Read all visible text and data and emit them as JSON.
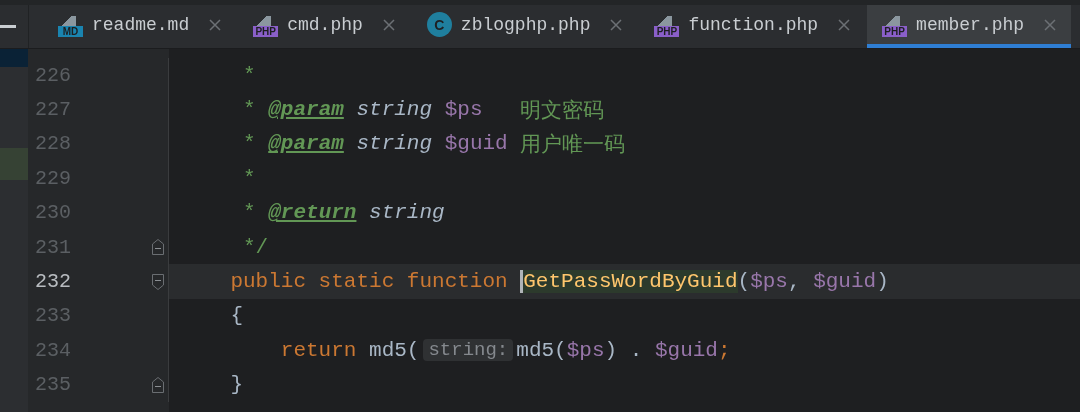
{
  "tabs": [
    {
      "label": "readme.md",
      "kind": "md",
      "icon_text": "MD",
      "selected": false
    },
    {
      "label": "cmd.php",
      "kind": "php",
      "icon_text": "PHP",
      "selected": false
    },
    {
      "label": "zblogphp.php",
      "kind": "class",
      "icon_text": "C",
      "selected": false
    },
    {
      "label": "function.php",
      "kind": "php",
      "icon_text": "PHP",
      "selected": false
    },
    {
      "label": "member.php",
      "kind": "php",
      "icon_text": "PHP",
      "selected": true
    }
  ],
  "lines": [
    {
      "number": "226",
      "current": false,
      "fold_start": false,
      "fold_end": false,
      "tokens": [
        {
          "kind": "comment",
          "text": "     *"
        }
      ]
    },
    {
      "number": "227",
      "current": false,
      "fold_start": false,
      "fold_end": false,
      "tokens": [
        {
          "kind": "comment",
          "text": "     * "
        },
        {
          "kind": "doctag",
          "text": "@param"
        },
        {
          "kind": "type",
          "text": " string "
        },
        {
          "kind": "var",
          "text": "$ps"
        },
        {
          "kind": "comment",
          "text": "   明文密码"
        }
      ]
    },
    {
      "number": "228",
      "current": false,
      "fold_start": false,
      "fold_end": false,
      "tokens": [
        {
          "kind": "comment",
          "text": "     * "
        },
        {
          "kind": "doctag",
          "text": "@param"
        },
        {
          "kind": "type",
          "text": " string "
        },
        {
          "kind": "var",
          "text": "$guid"
        },
        {
          "kind": "comment",
          "text": " 用户唯一码"
        }
      ]
    },
    {
      "number": "229",
      "current": false,
      "fold_start": false,
      "fold_end": false,
      "tokens": [
        {
          "kind": "comment",
          "text": "     *"
        }
      ]
    },
    {
      "number": "230",
      "current": false,
      "fold_start": false,
      "fold_end": false,
      "tokens": [
        {
          "kind": "comment",
          "text": "     * "
        },
        {
          "kind": "doctag",
          "text": "@return"
        },
        {
          "kind": "type",
          "text": " string"
        }
      ]
    },
    {
      "number": "231",
      "current": false,
      "fold_start": false,
      "fold_end": true,
      "tokens": [
        {
          "kind": "comment",
          "text": "     */"
        }
      ]
    },
    {
      "number": "232",
      "current": true,
      "fold_start": true,
      "fold_end": false,
      "tokens": [
        {
          "kind": "keyword",
          "text": "    public static function "
        },
        {
          "kind": "function",
          "text": "GetPassWordByGuid",
          "caret": true,
          "highlighted": true
        },
        {
          "kind": "plain",
          "text": "("
        },
        {
          "kind": "var",
          "text": "$ps"
        },
        {
          "kind": "plain",
          "text": ", "
        },
        {
          "kind": "var",
          "text": "$guid"
        },
        {
          "kind": "plain",
          "text": ")"
        }
      ]
    },
    {
      "number": "233",
      "current": false,
      "fold_start": false,
      "fold_end": false,
      "tokens": [
        {
          "kind": "plain",
          "text": "    {"
        }
      ]
    },
    {
      "number": "234",
      "current": false,
      "fold_start": false,
      "fold_end": false,
      "tokens": [
        {
          "kind": "keyword",
          "text": "        return "
        },
        {
          "kind": "plain",
          "text": "md5("
        },
        {
          "kind": "hint",
          "text": "string:"
        },
        {
          "kind": "plain",
          "text": "md5("
        },
        {
          "kind": "var",
          "text": "$ps"
        },
        {
          "kind": "plain",
          "text": ") . "
        },
        {
          "kind": "var",
          "text": "$guid"
        },
        {
          "kind": "keyword",
          "text": ";"
        }
      ]
    },
    {
      "number": "235",
      "current": false,
      "fold_start": false,
      "fold_end": true,
      "tokens": [
        {
          "kind": "plain",
          "text": "    }"
        }
      ]
    }
  ]
}
